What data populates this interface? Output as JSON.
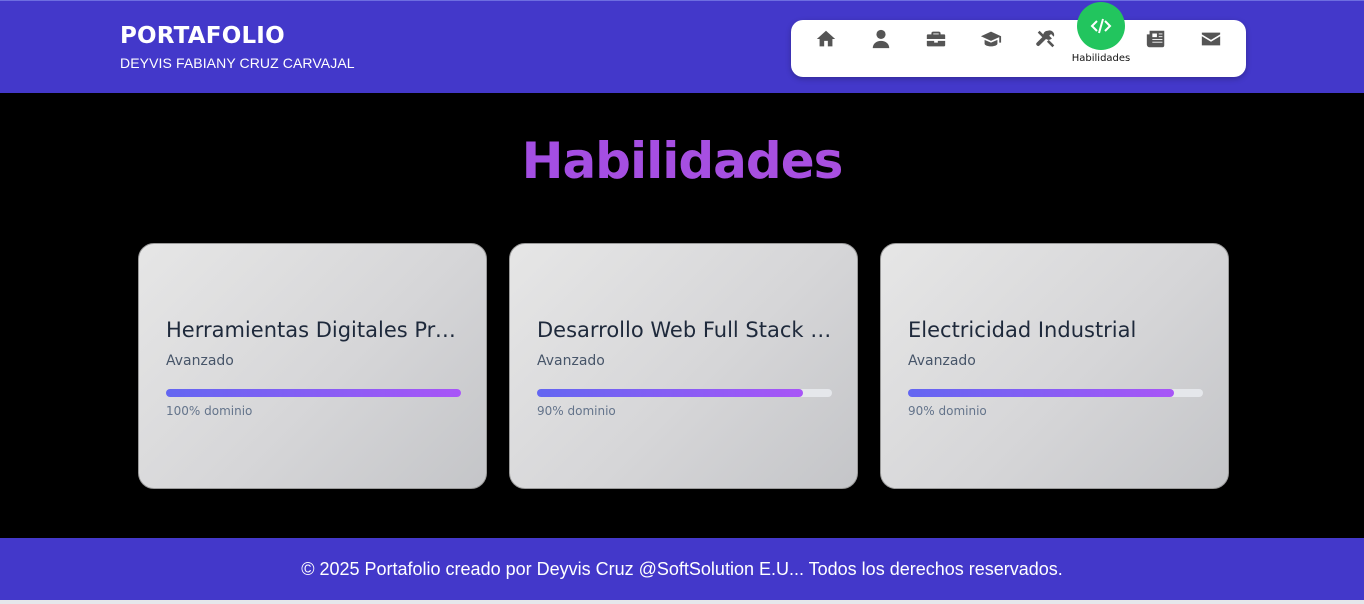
{
  "header": {
    "title": "PORTAFOLIO",
    "subtitle": "DEYVIS FABIANY CRUZ CARVAJAL",
    "nav": [
      {
        "icon": "home-icon"
      },
      {
        "icon": "user-icon"
      },
      {
        "icon": "briefcase-icon"
      },
      {
        "icon": "graduation-cap-icon"
      },
      {
        "icon": "tools-icon"
      },
      {
        "icon": "code-icon",
        "label": "Habilidades",
        "active": true
      },
      {
        "icon": "newspaper-icon"
      },
      {
        "icon": "envelope-icon"
      }
    ],
    "active_color": "#22c55e",
    "bg_color": "#4338ca"
  },
  "main": {
    "title": "Habilidades",
    "skills": [
      {
        "name": "Herramientas Digitales Profesionales",
        "level": "Avanzado",
        "percent": 100,
        "percent_label": "100% dominio"
      },
      {
        "name": "Desarrollo Web Full Stack - Python",
        "level": "Avanzado",
        "percent": 90,
        "percent_label": "90% dominio"
      },
      {
        "name": "Electricidad Industrial",
        "level": "Avanzado",
        "percent": 90,
        "percent_label": "90% dominio"
      }
    ]
  },
  "footer": {
    "text": "© 2025 Portafolio creado por Deyvis Cruz @SoftSolution E.U... Todos los derechos reservados."
  }
}
